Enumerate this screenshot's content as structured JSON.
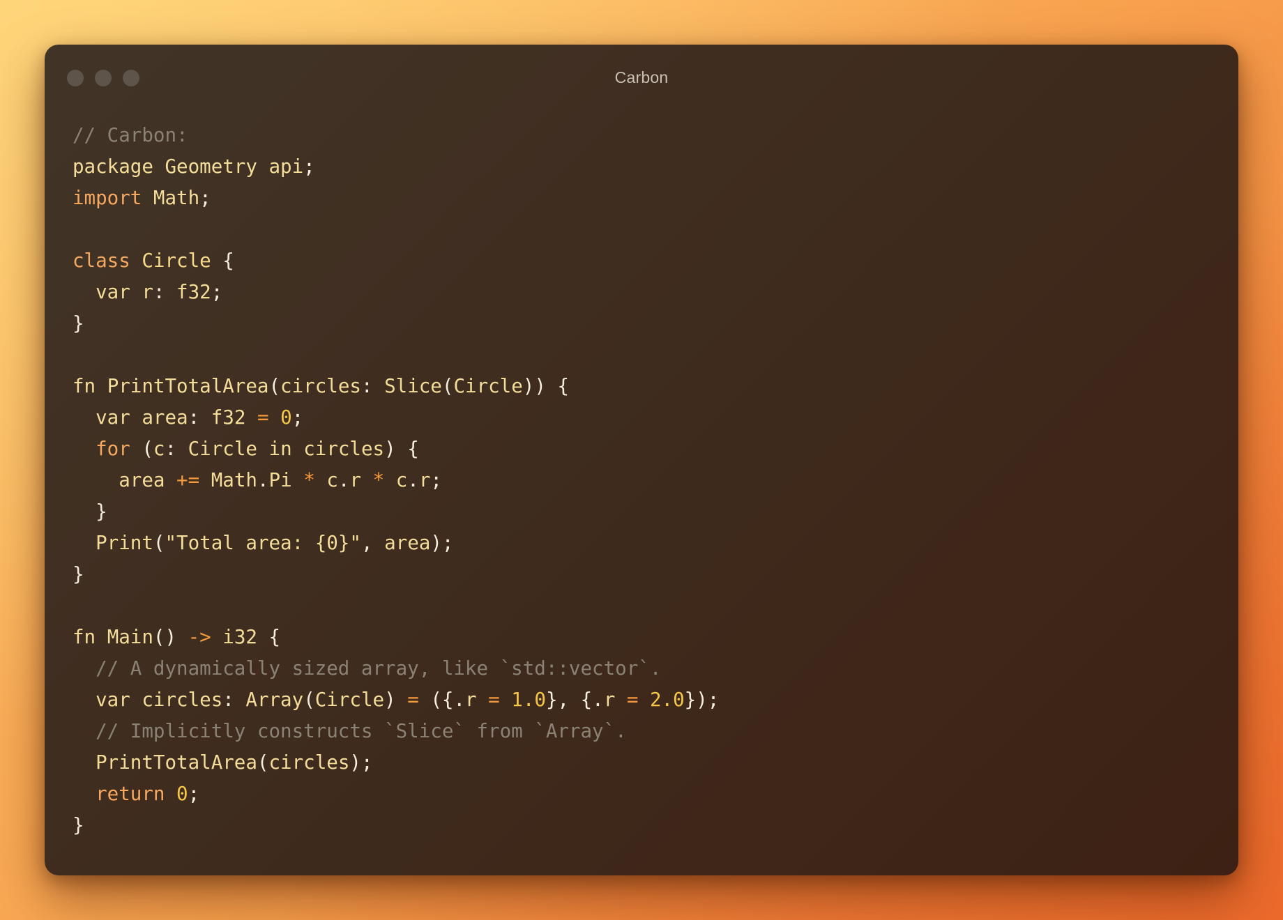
{
  "window": {
    "title": "Carbon",
    "traffic_lights": [
      "close",
      "minimize",
      "zoom"
    ]
  },
  "colors": {
    "window_bg": "#3e2a1c",
    "comment": "#8a8275",
    "keyword": "#f6a860",
    "identifier": "#f4dc9a",
    "number": "#f7c848",
    "operator": "#f59a3c",
    "punctuation": "#f6eedd"
  },
  "code": {
    "language": "Carbon",
    "lines": [
      [
        {
          "t": "// Carbon:",
          "k": "comment"
        }
      ],
      [
        {
          "t": "package",
          "k": "ident"
        },
        {
          "t": " ",
          "k": "punct"
        },
        {
          "t": "Geometry",
          "k": "ident"
        },
        {
          "t": " ",
          "k": "punct"
        },
        {
          "t": "api",
          "k": "ident"
        },
        {
          "t": ";",
          "k": "punct"
        }
      ],
      [
        {
          "t": "import",
          "k": "keyword"
        },
        {
          "t": " ",
          "k": "punct"
        },
        {
          "t": "Math",
          "k": "ident"
        },
        {
          "t": ";",
          "k": "punct"
        }
      ],
      [],
      [
        {
          "t": "class",
          "k": "keyword"
        },
        {
          "t": " ",
          "k": "punct"
        },
        {
          "t": "Circle",
          "k": "type"
        },
        {
          "t": " {",
          "k": "punct"
        }
      ],
      [
        {
          "t": "  ",
          "k": "punct"
        },
        {
          "t": "var",
          "k": "ident"
        },
        {
          "t": " ",
          "k": "punct"
        },
        {
          "t": "r",
          "k": "ident"
        },
        {
          "t": ": ",
          "k": "punct"
        },
        {
          "t": "f32",
          "k": "ident"
        },
        {
          "t": ";",
          "k": "punct"
        }
      ],
      [
        {
          "t": "}",
          "k": "punct"
        }
      ],
      [],
      [
        {
          "t": "fn",
          "k": "ident"
        },
        {
          "t": " ",
          "k": "punct"
        },
        {
          "t": "PrintTotalArea",
          "k": "ident"
        },
        {
          "t": "(",
          "k": "punct"
        },
        {
          "t": "circles",
          "k": "ident"
        },
        {
          "t": ": ",
          "k": "punct"
        },
        {
          "t": "Slice",
          "k": "ident"
        },
        {
          "t": "(",
          "k": "punct"
        },
        {
          "t": "Circle",
          "k": "ident"
        },
        {
          "t": ")) {",
          "k": "punct"
        }
      ],
      [
        {
          "t": "  ",
          "k": "punct"
        },
        {
          "t": "var",
          "k": "ident"
        },
        {
          "t": " ",
          "k": "punct"
        },
        {
          "t": "area",
          "k": "ident"
        },
        {
          "t": ": ",
          "k": "punct"
        },
        {
          "t": "f32",
          "k": "ident"
        },
        {
          "t": " ",
          "k": "punct"
        },
        {
          "t": "=",
          "k": "op"
        },
        {
          "t": " ",
          "k": "punct"
        },
        {
          "t": "0",
          "k": "number"
        },
        {
          "t": ";",
          "k": "punct"
        }
      ],
      [
        {
          "t": "  ",
          "k": "punct"
        },
        {
          "t": "for",
          "k": "keyword"
        },
        {
          "t": " (",
          "k": "punct"
        },
        {
          "t": "c",
          "k": "ident"
        },
        {
          "t": ": ",
          "k": "punct"
        },
        {
          "t": "Circle",
          "k": "ident"
        },
        {
          "t": " ",
          "k": "punct"
        },
        {
          "t": "in",
          "k": "ident"
        },
        {
          "t": " ",
          "k": "punct"
        },
        {
          "t": "circles",
          "k": "ident"
        },
        {
          "t": ") {",
          "k": "punct"
        }
      ],
      [
        {
          "t": "    ",
          "k": "punct"
        },
        {
          "t": "area",
          "k": "ident"
        },
        {
          "t": " ",
          "k": "punct"
        },
        {
          "t": "+=",
          "k": "op"
        },
        {
          "t": " ",
          "k": "punct"
        },
        {
          "t": "Math",
          "k": "ident"
        },
        {
          "t": ".",
          "k": "punct"
        },
        {
          "t": "Pi",
          "k": "ident"
        },
        {
          "t": " ",
          "k": "punct"
        },
        {
          "t": "*",
          "k": "op"
        },
        {
          "t": " ",
          "k": "punct"
        },
        {
          "t": "c",
          "k": "ident"
        },
        {
          "t": ".",
          "k": "punct"
        },
        {
          "t": "r",
          "k": "ident"
        },
        {
          "t": " ",
          "k": "punct"
        },
        {
          "t": "*",
          "k": "op"
        },
        {
          "t": " ",
          "k": "punct"
        },
        {
          "t": "c",
          "k": "ident"
        },
        {
          "t": ".",
          "k": "punct"
        },
        {
          "t": "r",
          "k": "ident"
        },
        {
          "t": ";",
          "k": "punct"
        }
      ],
      [
        {
          "t": "  }",
          "k": "punct"
        }
      ],
      [
        {
          "t": "  ",
          "k": "punct"
        },
        {
          "t": "Print",
          "k": "ident"
        },
        {
          "t": "(",
          "k": "punct"
        },
        {
          "t": "\"Total area: {0}\"",
          "k": "string"
        },
        {
          "t": ", ",
          "k": "punct"
        },
        {
          "t": "area",
          "k": "ident"
        },
        {
          "t": ");",
          "k": "punct"
        }
      ],
      [
        {
          "t": "}",
          "k": "punct"
        }
      ],
      [],
      [
        {
          "t": "fn",
          "k": "ident"
        },
        {
          "t": " ",
          "k": "punct"
        },
        {
          "t": "Main",
          "k": "ident"
        },
        {
          "t": "() ",
          "k": "punct"
        },
        {
          "t": "->",
          "k": "op"
        },
        {
          "t": " ",
          "k": "punct"
        },
        {
          "t": "i32",
          "k": "ident"
        },
        {
          "t": " {",
          "k": "punct"
        }
      ],
      [
        {
          "t": "  ",
          "k": "punct"
        },
        {
          "t": "// A dynamically sized array, like `std::vector`.",
          "k": "comment"
        }
      ],
      [
        {
          "t": "  ",
          "k": "punct"
        },
        {
          "t": "var",
          "k": "ident"
        },
        {
          "t": " ",
          "k": "punct"
        },
        {
          "t": "circles",
          "k": "ident"
        },
        {
          "t": ": ",
          "k": "punct"
        },
        {
          "t": "Array",
          "k": "ident"
        },
        {
          "t": "(",
          "k": "punct"
        },
        {
          "t": "Circle",
          "k": "ident"
        },
        {
          "t": ") ",
          "k": "punct"
        },
        {
          "t": "=",
          "k": "op"
        },
        {
          "t": " ({.",
          "k": "punct"
        },
        {
          "t": "r",
          "k": "ident"
        },
        {
          "t": " ",
          "k": "punct"
        },
        {
          "t": "=",
          "k": "op"
        },
        {
          "t": " ",
          "k": "punct"
        },
        {
          "t": "1.0",
          "k": "number"
        },
        {
          "t": "}, {.",
          "k": "punct"
        },
        {
          "t": "r",
          "k": "ident"
        },
        {
          "t": " ",
          "k": "punct"
        },
        {
          "t": "=",
          "k": "op"
        },
        {
          "t": " ",
          "k": "punct"
        },
        {
          "t": "2.0",
          "k": "number"
        },
        {
          "t": "});",
          "k": "punct"
        }
      ],
      [
        {
          "t": "  ",
          "k": "punct"
        },
        {
          "t": "// Implicitly constructs `Slice` from `Array`.",
          "k": "comment"
        }
      ],
      [
        {
          "t": "  ",
          "k": "punct"
        },
        {
          "t": "PrintTotalArea",
          "k": "ident"
        },
        {
          "t": "(",
          "k": "punct"
        },
        {
          "t": "circles",
          "k": "ident"
        },
        {
          "t": ");",
          "k": "punct"
        }
      ],
      [
        {
          "t": "  ",
          "k": "punct"
        },
        {
          "t": "return",
          "k": "keyword"
        },
        {
          "t": " ",
          "k": "punct"
        },
        {
          "t": "0",
          "k": "number"
        },
        {
          "t": ";",
          "k": "punct"
        }
      ],
      [
        {
          "t": "}",
          "k": "punct"
        }
      ]
    ]
  }
}
